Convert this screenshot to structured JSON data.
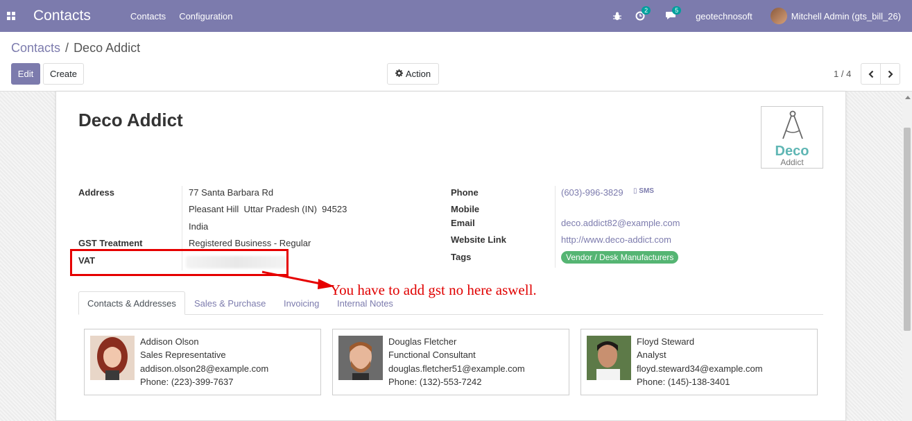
{
  "navbar": {
    "app_title": "Contacts",
    "menu": [
      "Contacts",
      "Configuration"
    ],
    "activity_count": "2",
    "messages_count": "5",
    "company": "geotechnosoft",
    "user": "Mitchell Admin (gts_bill_26)",
    "icons": [
      "apps-icon",
      "bug-icon",
      "clock-icon",
      "chat-icon"
    ]
  },
  "breadcrumb": {
    "parent": "Contacts",
    "separator": "/",
    "current": "Deco Addict"
  },
  "toolbar": {
    "edit_label": "Edit",
    "create_label": "Create",
    "action_label": "Action"
  },
  "pager": {
    "value": "1 / 4"
  },
  "record": {
    "name": "Deco Addict",
    "logo": {
      "line1": "Deco",
      "line2": "Addict"
    },
    "address_label": "Address",
    "address_line1": "77 Santa Barbara Rd",
    "address_line2": "Pleasant Hill  Uttar Pradesh (IN)  94523",
    "address_line3": "India",
    "gst_label": "GST Treatment",
    "gst_value": "Registered Business - Regular",
    "vat_label": "VAT",
    "phone_label": "Phone",
    "phone_value": "(603)-996-3829",
    "sms_label": "SMS",
    "mobile_label": "Mobile",
    "email_label": "Email",
    "email_value": "deco.addict82@example.com",
    "website_label": "Website Link",
    "website_value": "http://www.deco-addict.com",
    "tags_label": "Tags",
    "tag_value": "Vendor / Desk Manufacturers"
  },
  "annotation": {
    "text": "You have to add gst no here aswell.",
    "color": "#e00000"
  },
  "tabs": [
    "Contacts & Addresses",
    "Sales & Purchase",
    "Invoicing",
    "Internal Notes"
  ],
  "contacts": [
    {
      "name": "Addison Olson",
      "title": "Sales Representative",
      "email": "addison.olson28@example.com",
      "phone": "Phone: (223)-399-7637"
    },
    {
      "name": "Douglas Fletcher",
      "title": "Functional Consultant",
      "email": "douglas.fletcher51@example.com",
      "phone": "Phone: (132)-553-7242"
    },
    {
      "name": "Floyd Steward",
      "title": "Analyst",
      "email": "floyd.steward34@example.com",
      "phone": "Phone: (145)-138-3401"
    }
  ],
  "colors": {
    "brand": "#7c7bad",
    "tag": "#55b573",
    "badge": "#00a09d",
    "annotation": "#e00000"
  }
}
